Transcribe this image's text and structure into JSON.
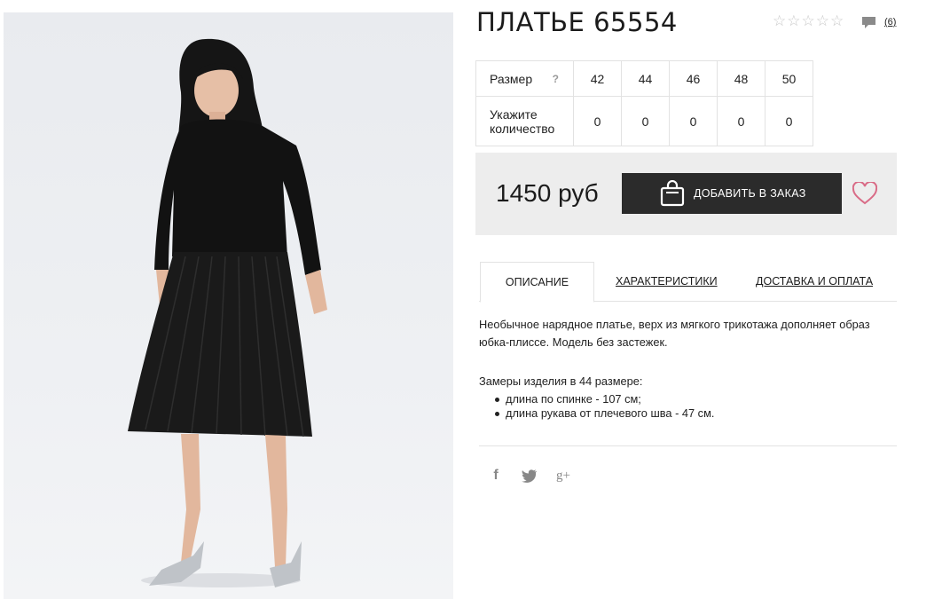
{
  "product": {
    "title": "ПЛАТЬЕ 65554",
    "review_count": "(6)",
    "rating_stars": 0,
    "image_icon": "product-photo-model-black-pleated-dress"
  },
  "sizes": {
    "size_label": "Размер",
    "help_mark": "?",
    "qty_label": "Укажите количество",
    "columns": [
      {
        "size": "42",
        "qty": "0"
      },
      {
        "size": "44",
        "qty": "0"
      },
      {
        "size": "46",
        "qty": "0"
      },
      {
        "size": "48",
        "qty": "0"
      },
      {
        "size": "50",
        "qty": "0"
      }
    ]
  },
  "purchase": {
    "price": "1450 руб",
    "add_button_label": "ДОБАВИТЬ В ЗАКАЗ",
    "accent_color": "#d96b86"
  },
  "tabs": [
    {
      "label": "ОПИСАНИЕ",
      "active": true
    },
    {
      "label": "ХАРАКТЕРИСТИКИ",
      "active": false
    },
    {
      "label": "ДОСТАВКА И ОПЛАТА",
      "active": false
    }
  ],
  "description": {
    "text": "Необычное нарядное платье, верх из мягкого трикотажа дополняет образ юбка-плиссе. Модель без застежек.",
    "measure_title": "Замеры изделия в 44 размере:",
    "measures": [
      "длина по спинке - 107 см;",
      "длина рукава от плечевого шва - 47 см."
    ]
  },
  "social": {
    "facebook": "f",
    "twitter": "🐦",
    "googleplus": "g+"
  }
}
